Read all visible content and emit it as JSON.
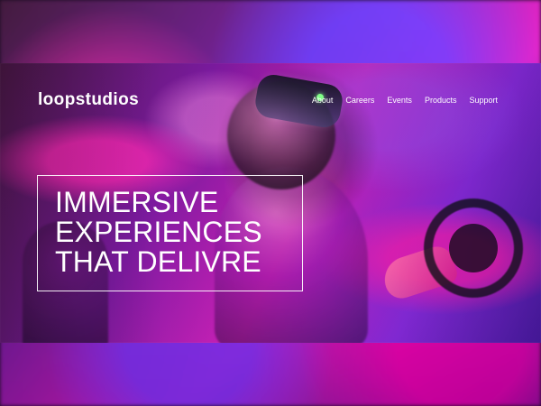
{
  "site": {
    "logo": "loopstudios",
    "nav": [
      {
        "label": "About"
      },
      {
        "label": "Careers"
      },
      {
        "label": "Events"
      },
      {
        "label": "Products"
      },
      {
        "label": "Support"
      }
    ],
    "headline": [
      "IMMERSIVE",
      "EXPERIENCES",
      "THAT DELIVRE"
    ]
  },
  "colors": {
    "text": "#ffffff",
    "accent_magenta": "#d223b5",
    "accent_purple": "#6d1e8f"
  }
}
